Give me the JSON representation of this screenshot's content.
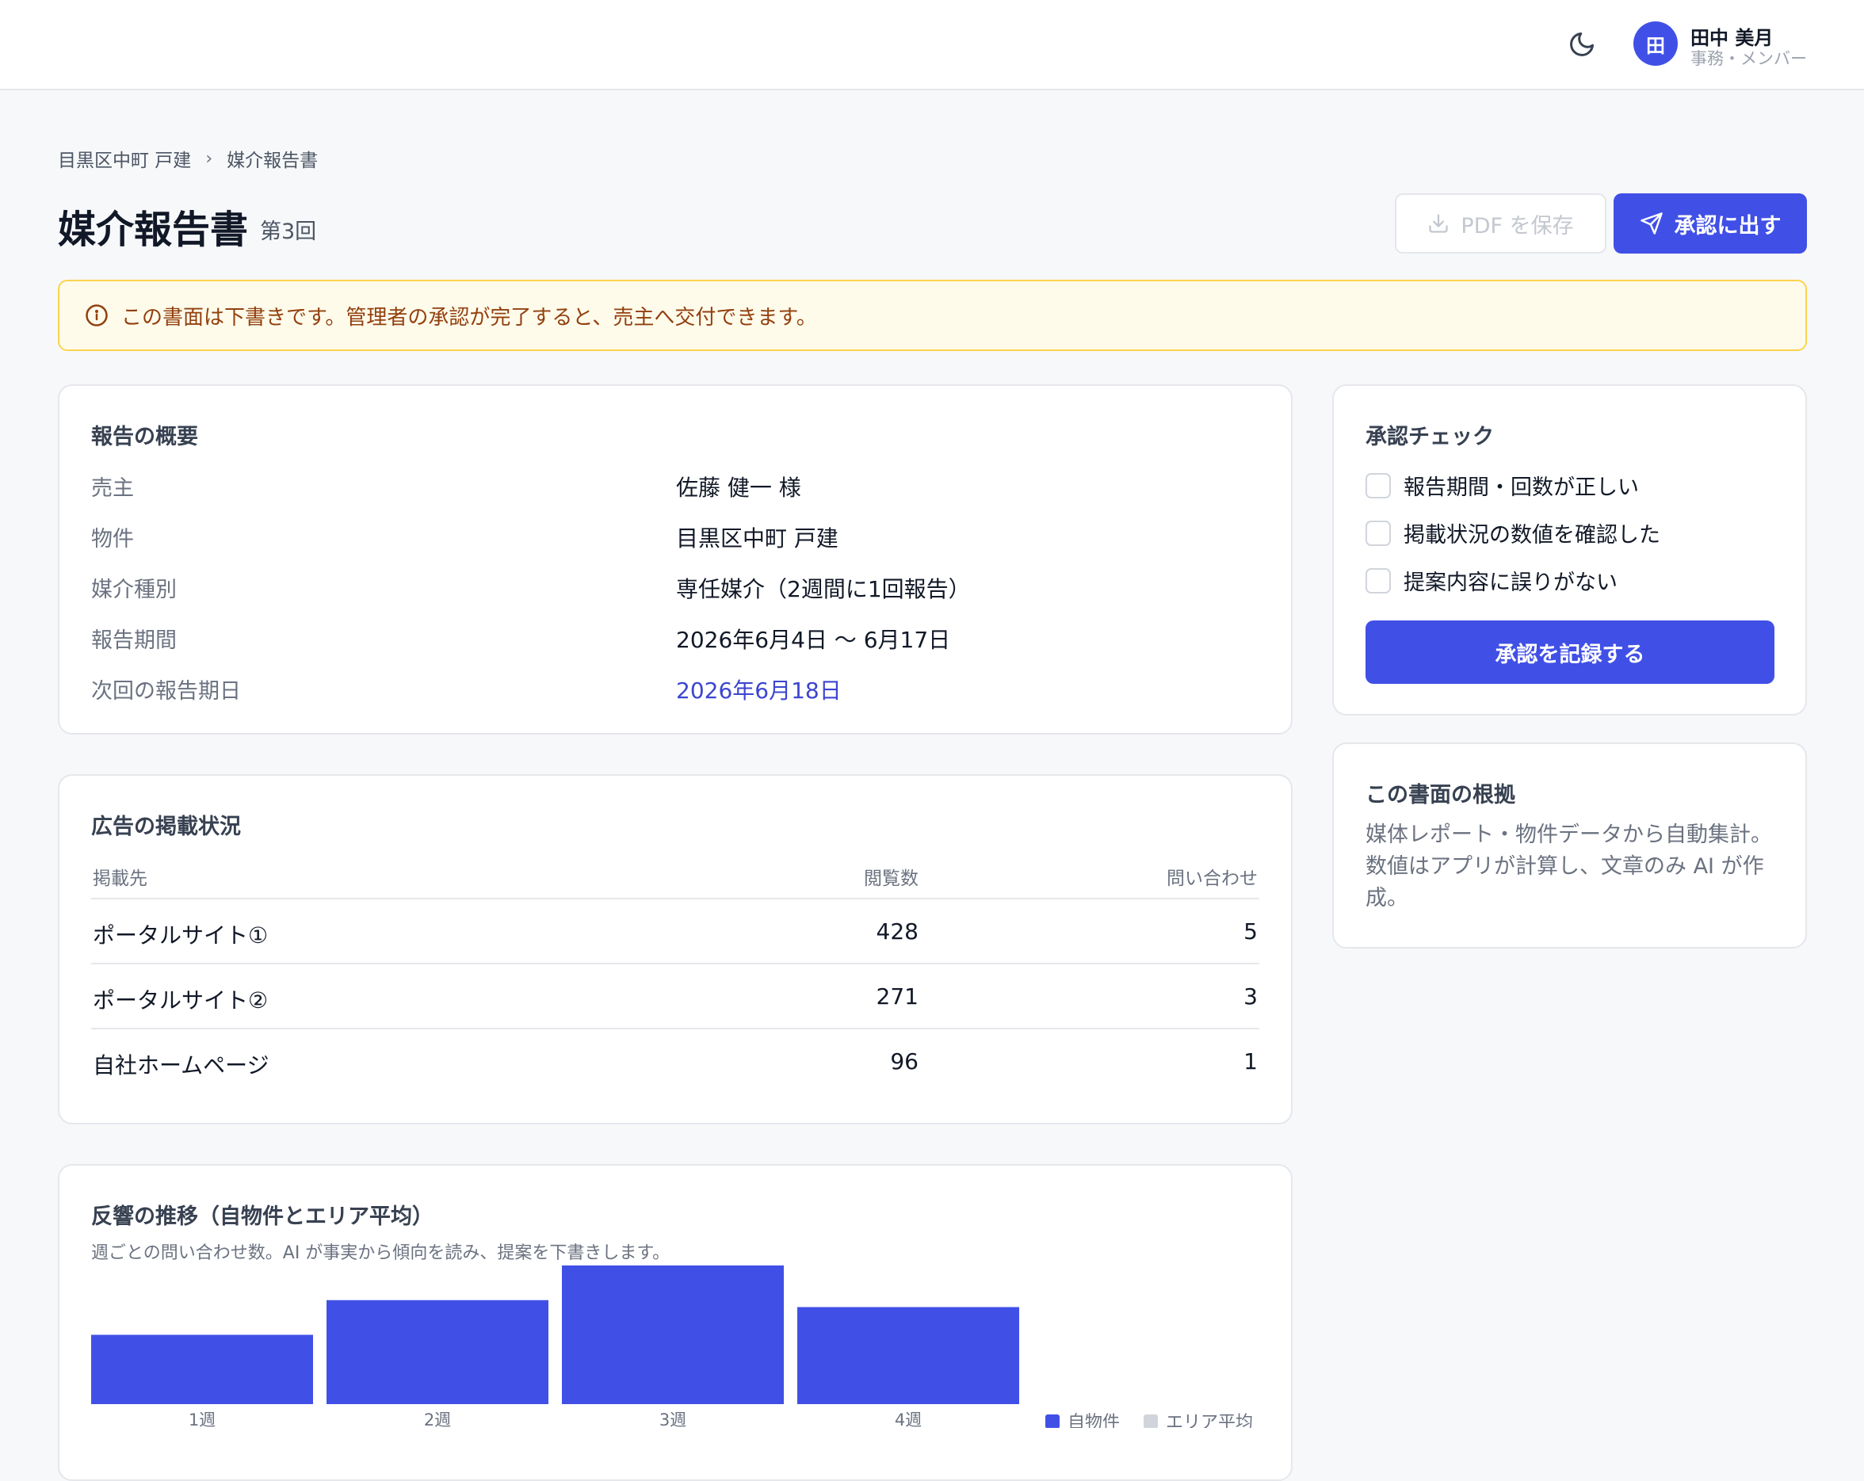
{
  "header": {
    "theme_icon": "moon-icon",
    "avatar_initial": "田",
    "user_name": "田中 美月",
    "user_role": "事務・メンバー"
  },
  "breadcrumb": {
    "items": [
      "目黒区中町 戸建",
      "媒介報告書"
    ],
    "separator": "›"
  },
  "page": {
    "title": "媒介報告書",
    "subtitle": "第3回",
    "pdf_button": "PDF を保存",
    "submit_button": "承認に出す"
  },
  "notice": {
    "text": "この書面は下書きです。管理者の承認が完了すると、売主へ交付できます。",
    "icon": "info-icon"
  },
  "summary": {
    "title": "報告の概要",
    "rows": [
      {
        "label": "売主",
        "value": "佐藤 健一 様"
      },
      {
        "label": "物件",
        "value": "目黒区中町 戸建"
      },
      {
        "label": "媒介種別",
        "value": "専任媒介（2週間に1回報告）"
      },
      {
        "label": "報告期間",
        "value": "2026年6月4日 〜 6月17日"
      },
      {
        "label": "次回の報告期日",
        "value": "2026年6月18日"
      }
    ]
  },
  "ads": {
    "title": "広告の掲載状況",
    "columns": [
      "掲載先",
      "閲覧数",
      "問い合わせ"
    ],
    "rows": [
      {
        "site": "ポータルサイト①",
        "views": "428",
        "inquiries": "5"
      },
      {
        "site": "ポータルサイト②",
        "views": "271",
        "inquiries": "3"
      },
      {
        "site": "自社ホームページ",
        "views": "96",
        "inquiries": "1"
      }
    ]
  },
  "chart": {
    "title": "反響の推移（自物件とエリア平均）",
    "subtitle": "週ごとの問い合わせ数。AI が事実から傾向を読み、提案を下書きします。"
  },
  "chart_data": {
    "type": "bar",
    "categories": [
      "1週",
      "2週",
      "3週",
      "4週"
    ],
    "series": [
      {
        "name": "自物件",
        "values": [
          2,
          3,
          4,
          2.8
        ],
        "color": "#4050e6"
      },
      {
        "name": "エリア平均",
        "values": [],
        "color": "#d1d5db"
      }
    ],
    "legend_position": "bottom-right",
    "grid": false
  },
  "checklist": {
    "title": "承認チェック",
    "items": [
      "報告期間・回数が正しい",
      "掲載状況の数値を確認した",
      "提案内容に誤りがない"
    ],
    "checked": [
      false,
      false,
      false
    ],
    "button": "承認を記録する"
  },
  "basis": {
    "title": "この書面の根拠",
    "text": "媒体レポート・物件データから自動集計。数値はアプリが計算し、文章のみ AI が作成。"
  },
  "colors": {
    "accent": "#4050e6",
    "notice_bg": "#fffbeb",
    "notice_border": "#fcd34d",
    "notice_text": "#92400e",
    "link": "#3b45d0"
  }
}
